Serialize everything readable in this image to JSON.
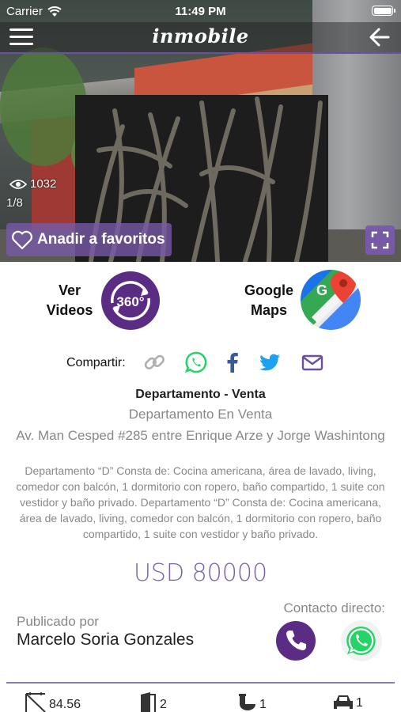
{
  "status_bar": {
    "carrier": "Carrier",
    "time": "11:49 PM"
  },
  "nav": {
    "logo": "inmobile"
  },
  "gallery": {
    "views": "1032",
    "pager": "1/8",
    "favorite_label": "Anadir a favoritos"
  },
  "actions": {
    "videos_label_line1": "Ver",
    "videos_label_line2": "Videos",
    "badge_360": "360°",
    "maps_label_line1": "Google",
    "maps_label_line2": "Maps"
  },
  "share": {
    "label": "Compartir:"
  },
  "listing": {
    "type": "Departamento - Venta",
    "title": "Departamento En Venta",
    "address": "Av. Man Cesped #285 entre Enrique Arze y Jorge Washintong",
    "description": "Departamento “D”   Consta de: Cocina americana, área de lavado, living, comedor con balcón, 1 dormitorio con ropero, baño compartido, 1 suite con vestidor y baño privado. Departamento “D”   Consta de: Cocina americana, área de lavado, living, comedor con balcón, 1 dormitorio con ropero, baño compartido, 1 suite con vestidor y baño privado.",
    "price": "USD 80000"
  },
  "contact": {
    "published_by_label": "Publicado por",
    "publisher_name": "Marcelo Soria Gonzales",
    "direct_contact_label": "Contacto directo:"
  },
  "features": {
    "area": "84.56",
    "rooms": "2",
    "baths": "1",
    "parking": "1"
  },
  "colors": {
    "accent": "#5a2c83",
    "price": "#7a60b2",
    "whatsapp": "#25d366",
    "facebook": "#3b5998",
    "twitter": "#1da1f2"
  }
}
